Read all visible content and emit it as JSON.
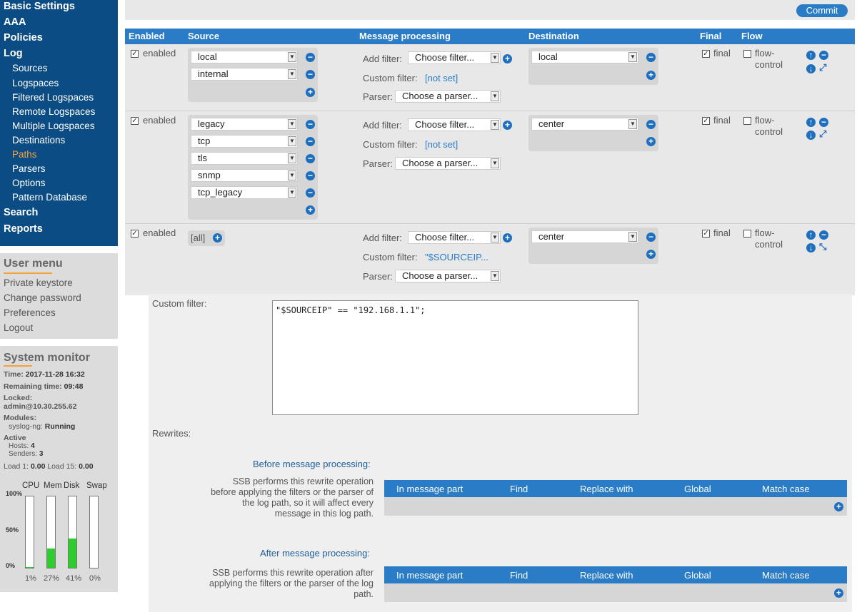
{
  "nav": {
    "basic_settings": "Basic Settings",
    "aaa": "AAA",
    "policies": "Policies",
    "log": "Log",
    "log_items": [
      "Sources",
      "Logspaces",
      "Filtered Logspaces",
      "Remote Logspaces",
      "Multiple Logspaces",
      "Destinations",
      "Paths",
      "Parsers",
      "Options",
      "Pattern Database"
    ],
    "active_item": "Paths",
    "search": "Search",
    "reports": "Reports"
  },
  "user_menu": {
    "title": "User menu",
    "items": [
      "Private keystore",
      "Change password",
      "Preferences",
      "Logout"
    ]
  },
  "system_monitor": {
    "title": "System monitor",
    "time_label": "Time:",
    "time": "2017-11-28 16:32",
    "remaining_label": "Remaining time:",
    "remaining": "09:48",
    "locked_label": "Locked:",
    "locked": "admin@10.30.255.62",
    "modules_label": "Modules:",
    "module_name": "syslog-ng:",
    "module_status": "Running",
    "active_label": "Active",
    "hosts_label": "Hosts:",
    "hosts": "4",
    "senders_label": "Senders:",
    "senders": "3",
    "load1_label": "Load 1:",
    "load1": "0.00",
    "load15_label": "Load 15:",
    "load15": "0.00",
    "bars": [
      {
        "label": "CPU",
        "pct_text": "1%",
        "value": 0.01
      },
      {
        "label": "Mem",
        "pct_text": "27%",
        "value": 0.27
      },
      {
        "label": "Disk",
        "pct_text": "41%",
        "value": 0.41
      },
      {
        "label": "Swap",
        "pct_text": "0%",
        "value": 0.0
      }
    ],
    "scale": [
      "100%",
      "50%",
      "0%"
    ]
  },
  "toolbar": {
    "commit": "Commit"
  },
  "table_headers": [
    "Enabled",
    "Source",
    "Message processing",
    "Destination",
    "Final",
    "Flow"
  ],
  "common": {
    "enabled": "enabled",
    "final": "final",
    "flow_control": "flow-control",
    "flow": "flow-",
    "control": "control",
    "add_filter": "Add filter:",
    "choose_filter": "Choose filter...",
    "custom_filter": "Custom filter:",
    "parser": "Parser:",
    "choose_parser": "Choose a parser..."
  },
  "paths": [
    {
      "sources": [
        "local",
        "internal"
      ],
      "custom_filter": "[not set]",
      "destination": "local"
    },
    {
      "sources": [
        "legacy",
        "tcp",
        "tls",
        "snmp",
        "tcp_legacy"
      ],
      "custom_filter": "[not set]",
      "destination": "center"
    },
    {
      "sources": [
        "[all]"
      ],
      "custom_filter": "\"$SOURCEIP...",
      "destination": "center"
    }
  ],
  "custom_filter_panel": {
    "label": "Custom filter:",
    "value": "\"$SOURCEIP\" == \"192.168.1.1\";",
    "rewrites_label": "Rewrites:",
    "before_title": "Before message processing:",
    "before_desc": "SSB performs this rewrite operation before applying the filters or the parser of the log path, so it will affect every message in this log path.",
    "after_title": "After message processing:",
    "after_desc": "SSB performs this rewrite operation after applying the filters or the parser of the log path.",
    "rewrite_headers": [
      "In message part",
      "Find",
      "Replace with",
      "Global",
      "Match case"
    ]
  }
}
